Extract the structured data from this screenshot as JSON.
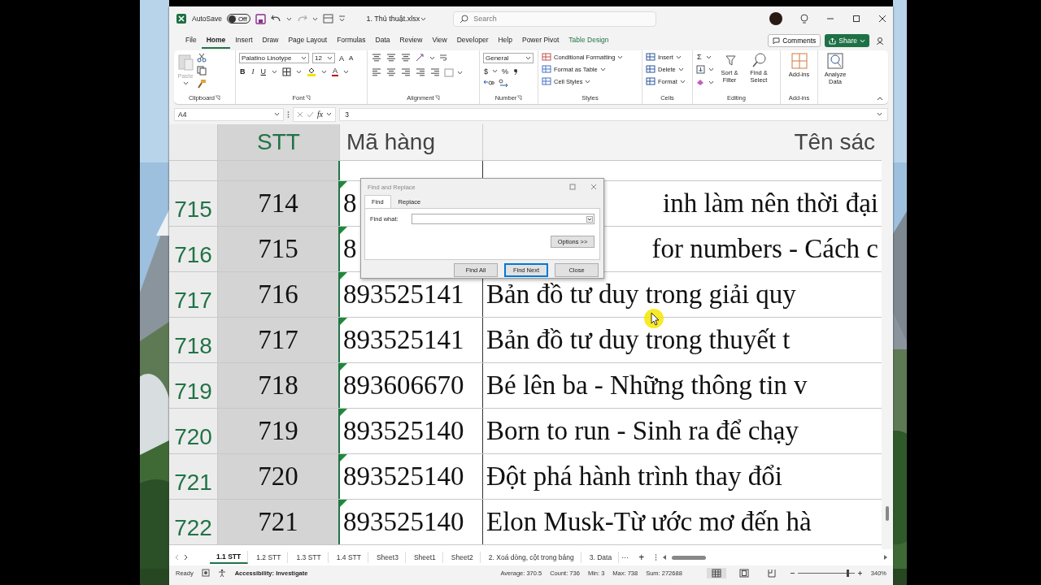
{
  "title_bar": {
    "autosave_label": "AutoSave",
    "autosave_toggle": {
      "label": "Off",
      "on": false
    },
    "file_name": "1. Thủ thuật.xlsx",
    "search": {
      "placeholder": "Search"
    }
  },
  "menu_tabs": [
    {
      "label": "File",
      "selected": false,
      "kind": "normal"
    },
    {
      "label": "Home",
      "selected": true,
      "kind": "normal"
    },
    {
      "label": "Insert",
      "selected": false,
      "kind": "normal"
    },
    {
      "label": "Draw",
      "selected": false,
      "kind": "normal"
    },
    {
      "label": "Page Layout",
      "selected": false,
      "kind": "normal"
    },
    {
      "label": "Formulas",
      "selected": false,
      "kind": "normal"
    },
    {
      "label": "Data",
      "selected": false,
      "kind": "normal"
    },
    {
      "label": "Review",
      "selected": false,
      "kind": "normal"
    },
    {
      "label": "View",
      "selected": false,
      "kind": "normal"
    },
    {
      "label": "Developer",
      "selected": false,
      "kind": "normal"
    },
    {
      "label": "Help",
      "selected": false,
      "kind": "normal"
    },
    {
      "label": "Power Pivot",
      "selected": false,
      "kind": "normal"
    },
    {
      "label": "Table Design",
      "selected": false,
      "kind": "contextual"
    }
  ],
  "comments_button": "Comments",
  "share_button": "Share",
  "ribbon": {
    "clipboard": {
      "paste": "Paste",
      "paste_disabled": true,
      "label": "Clipboard"
    },
    "font": {
      "font_name": "Palatino Linotype",
      "font_size": "12",
      "grow": "A",
      "shrink": "A",
      "bold": "B",
      "italic": "I",
      "underline": "U",
      "font_color": "A",
      "label": "Font"
    },
    "alignment": {
      "label": "Alignment"
    },
    "number": {
      "format": "General",
      "currency": "$",
      "percent": "%",
      "label": "Number"
    },
    "styles": {
      "items": [
        "Conditional Formatting",
        "Format as Table",
        "Cell Styles"
      ],
      "label": "Styles"
    },
    "cells": {
      "items": [
        "Insert",
        "Delete",
        "Format"
      ],
      "label": "Cells"
    },
    "editing": {
      "sum": "Σ",
      "sort_filter": "Sort & Filter",
      "find_select": "Find & Select",
      "label": "Editing"
    },
    "addins": {
      "button": "Add-ins",
      "label": "Add-ins"
    },
    "analyze": {
      "button": "Analyze Data"
    }
  },
  "formula_bar": {
    "name_box": "A4",
    "fx": "fx",
    "value": "3"
  },
  "grid": {
    "columns": [
      {
        "label": "STT",
        "selected": true
      },
      {
        "label": "Mã hàng",
        "selected": false
      },
      {
        "label": "Tên sác",
        "selected": false
      }
    ],
    "rows": [
      {
        "header": "715",
        "covered": true,
        "cells": [
          "714",
          "8",
          "inh làm nên thời đại"
        ]
      },
      {
        "header": "716",
        "covered": true,
        "cells": [
          "715",
          "8",
          "for numbers - Cách c"
        ]
      },
      {
        "header": "717",
        "covered": false,
        "cells": [
          "716",
          "893525141",
          "Bản đồ tư duy trong giải quy"
        ]
      },
      {
        "header": "718",
        "covered": false,
        "cells": [
          "717",
          "893525141",
          "Bản đồ tư duy trong thuyết t"
        ]
      },
      {
        "header": "719",
        "covered": false,
        "cells": [
          "718",
          "893606670",
          "Bé lên ba - Những thông tin v"
        ]
      },
      {
        "header": "720",
        "covered": false,
        "cells": [
          "719",
          "893525140",
          "Born to run - Sinh ra để chạy"
        ]
      },
      {
        "header": "721",
        "covered": false,
        "cells": [
          "720",
          "893525140",
          "Đột phá hành trình thay đổi"
        ]
      },
      {
        "header": "722",
        "covered": false,
        "cells": [
          "721",
          "893525140",
          "Elon Musk-Từ ước mơ đến hà"
        ]
      }
    ]
  },
  "find_dialog": {
    "title": "Find and Replace",
    "tabs": [
      {
        "label": "Find",
        "selected": true
      },
      {
        "label": "Replace",
        "selected": false
      }
    ],
    "find_label": "Find what:",
    "options_button": "Options >>",
    "buttons": [
      {
        "label": "Find All",
        "selected": false
      },
      {
        "label": "Find Next",
        "selected": true
      },
      {
        "label": "Close",
        "selected": false
      }
    ]
  },
  "sheet_tabs": [
    {
      "label": "1.1 STT",
      "selected": true
    },
    {
      "label": "1.2 STT",
      "selected": false
    },
    {
      "label": "1.3 STT",
      "selected": false
    },
    {
      "label": "1.4 STT",
      "selected": false
    },
    {
      "label": "Sheet3",
      "selected": false
    },
    {
      "label": "Sheet1",
      "selected": false
    },
    {
      "label": "Sheet2",
      "selected": false
    },
    {
      "label": "2. Xoá dòng, cột trong bảng",
      "selected": false
    },
    {
      "label": "3. Data",
      "selected": false
    }
  ],
  "sheet_more": "···",
  "sheet_add": "+",
  "status_bar": {
    "mode": "Ready",
    "accessibility": "Accessibility: Investigate",
    "stats": [
      "Average: 370.5",
      "Count: 736",
      "Min: 3",
      "Max: 738",
      "Sum: 272688"
    ],
    "views": [
      {
        "kind": "normal",
        "selected": true
      },
      {
        "kind": "page_layout",
        "selected": false
      },
      {
        "kind": "page_break",
        "selected": false
      }
    ],
    "zoom": "340%",
    "zoom_slider": {
      "level": 0.86
    }
  }
}
